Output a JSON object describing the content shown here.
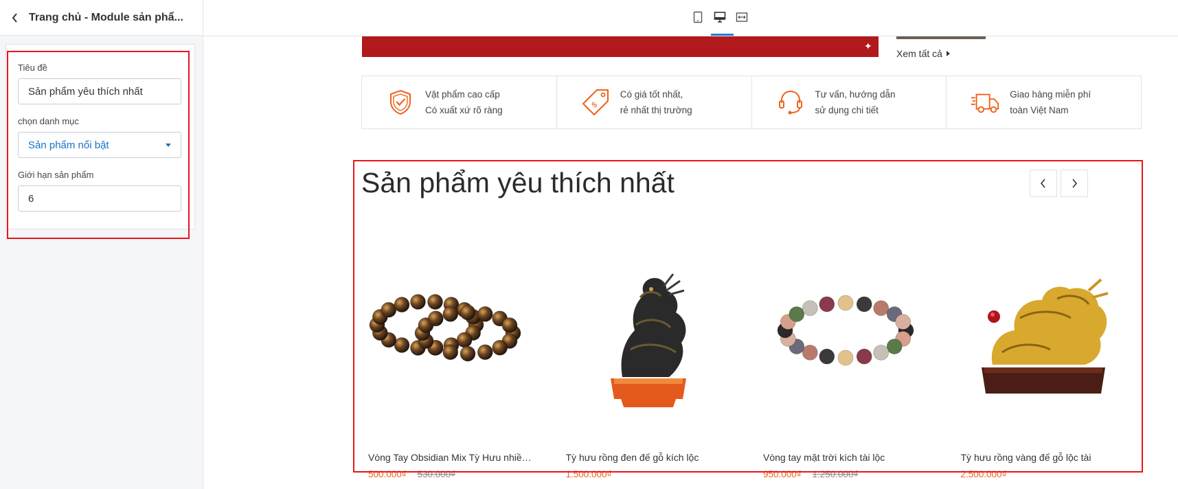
{
  "sidebar": {
    "title": "Trang chủ - Module sản phẩ...",
    "fields": {
      "title_label": "Tiêu đề",
      "title_value": "Sản phẩm yêu thích nhất",
      "category_label": "chọn danh mục",
      "category_value": "Sản phẩm nổi bật",
      "limit_label": "Giới hạn sản phẩm",
      "limit_value": "6"
    }
  },
  "toolbar": {
    "devices": [
      "tablet-icon",
      "desktop-icon",
      "fullwidth-icon"
    ],
    "active_device": "desktop",
    "accent_color": "#2b7bd6"
  },
  "preview": {
    "see_all": "Xem tất cả",
    "banner_color": "#b1191d",
    "features": [
      {
        "icon": "shield-check-icon",
        "line1": "Vật phẩm cao cấp",
        "line2": "Có xuất xứ rõ ràng"
      },
      {
        "icon": "price-tag-icon",
        "line1": "Có giá tốt nhất,",
        "line2": "rẻ nhất thị trường"
      },
      {
        "icon": "headset-icon",
        "line1": "Tư vấn, hướng dẫn",
        "line2": "sử dụng chi tiết"
      },
      {
        "icon": "delivery-truck-icon",
        "line1": "Giao hàng miễn phí",
        "line2": "toàn Việt Nam"
      }
    ],
    "section_title": "Sản phẩm yêu thích nhất",
    "products": [
      {
        "name": "Vòng Tay Obsidian Mix Tỳ Hưu nhiều màu",
        "price": "500.000₫",
        "old_price": "530.000₫",
        "image": "tiger-eye-bracelet"
      },
      {
        "name": "Tỳ hưu rồng đen đế gỗ kích lộc",
        "price": "1.500.000₫",
        "old_price": "",
        "image": "black-dragon-statue"
      },
      {
        "name": "Vòng tay mặt trời kích tài lộc",
        "price": "950.000₫",
        "old_price": "1.250.000₫",
        "image": "tourmaline-bracelet"
      },
      {
        "name": "Tỳ hưu rồng vàng đế gỗ lộc tài",
        "price": "2.500.000₫",
        "old_price": "",
        "image": "gold-dragon-statue"
      }
    ],
    "accent_color": "#f0611a",
    "highlight_color": "#e8141c"
  }
}
